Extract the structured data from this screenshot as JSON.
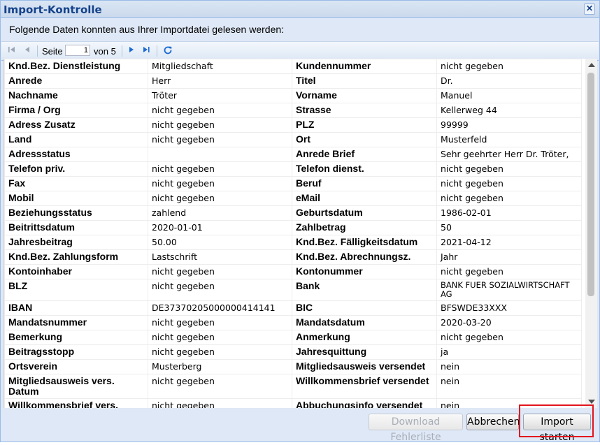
{
  "window": {
    "title": "Import-Kontrolle",
    "close_glyph": "✕"
  },
  "intro": "Folgende Daten konnten aus Ihrer Importdatei gelesen werden:",
  "pager": {
    "page_label": "Seite",
    "page_value": "1",
    "of_label": "von 5",
    "icons": [
      "first-page-icon",
      "prev-page-icon",
      "next-page-icon",
      "last-page-icon",
      "refresh-icon"
    ]
  },
  "rows": [
    {
      "l1": "Knd.Bez. Dienstleistung",
      "v1": "Mitgliedschaft",
      "l2": "Kundennummer",
      "v2": "nicht gegeben"
    },
    {
      "l1": "Anrede",
      "v1": "Herr",
      "l2": "Titel",
      "v2": "Dr."
    },
    {
      "l1": "Nachname",
      "v1": "Tröter",
      "l2": "Vorname",
      "v2": "Manuel"
    },
    {
      "l1": "Firma / Org",
      "v1": "nicht gegeben",
      "l2": "Strasse",
      "v2": "Kellerweg 44"
    },
    {
      "l1": "Adress Zusatz",
      "v1": "nicht gegeben",
      "l2": "PLZ",
      "v2": "99999"
    },
    {
      "l1": "Land",
      "v1": "nicht gegeben",
      "l2": "Ort",
      "v2": "Musterfeld"
    },
    {
      "l1": "Adressstatus",
      "v1": "",
      "l2": "Anrede Brief",
      "v2": "Sehr geehrter Herr Dr. Tröter,"
    },
    {
      "l1": "Telefon priv.",
      "v1": "nicht gegeben",
      "l2": "Telefon dienst.",
      "v2": "nicht gegeben"
    },
    {
      "l1": "Fax",
      "v1": "nicht gegeben",
      "l2": "Beruf",
      "v2": "nicht gegeben"
    },
    {
      "l1": "Mobil",
      "v1": "nicht gegeben",
      "l2": "eMail",
      "v2": "nicht gegeben"
    },
    {
      "l1": "Beziehungsstatus",
      "v1": "zahlend",
      "l2": "Geburtsdatum",
      "v2": "1986-02-01"
    },
    {
      "l1": "Beitrittsdatum",
      "v1": "2020-01-01",
      "l2": "Zahlbetrag",
      "v2": "50"
    },
    {
      "l1": "Jahresbeitrag",
      "v1": "50.00",
      "l2": "Knd.Bez. Fälligkeitsdatum",
      "v2": "2021-04-12"
    },
    {
      "l1": "Knd.Bez. Zahlungsform",
      "v1": "Lastschrift",
      "l2": "Knd.Bez. Abrechnungsz.",
      "v2": "Jahr"
    },
    {
      "l1": "Kontoinhaber",
      "v1": "nicht gegeben",
      "l2": "Kontonummer",
      "v2": "nicht gegeben"
    },
    {
      "l1": "BLZ",
      "v1": "nicht gegeben",
      "l2": "Bank",
      "v2": "BANK FUER SOZIALWIRTSCHAFT AG"
    },
    {
      "l1": "IBAN",
      "v1": "DE37370205000000414141",
      "l2": "BIC",
      "v2": "BFSWDE33XXX"
    },
    {
      "l1": "Mandatsnummer",
      "v1": "nicht gegeben",
      "l2": "Mandatsdatum",
      "v2": "2020-03-20"
    },
    {
      "l1": "Bemerkung",
      "v1": "nicht gegeben",
      "l2": "Anmerkung",
      "v2": "nicht gegeben"
    },
    {
      "l1": "Beitragsstopp",
      "v1": "nicht gegeben",
      "l2": "Jahresquittung",
      "v2": "ja"
    },
    {
      "l1": "Ortsverein",
      "v1": "Musterberg",
      "l2": "Mitgliedsausweis versendet",
      "v2": "nein"
    },
    {
      "l1": "Mitgliedsausweis vers. Datum",
      "v1": "nicht gegeben",
      "l2": "Willkommensbrief versendet",
      "v2": "nein"
    },
    {
      "l1": "Willkommensbrief vers.",
      "v1": "nicht gegeben",
      "l2": "Abbuchungsinfo versendet",
      "v2": "nein"
    }
  ],
  "buttons": {
    "download": "Download Fehlerliste",
    "cancel": "Abbrechen",
    "start": "Import starten"
  }
}
